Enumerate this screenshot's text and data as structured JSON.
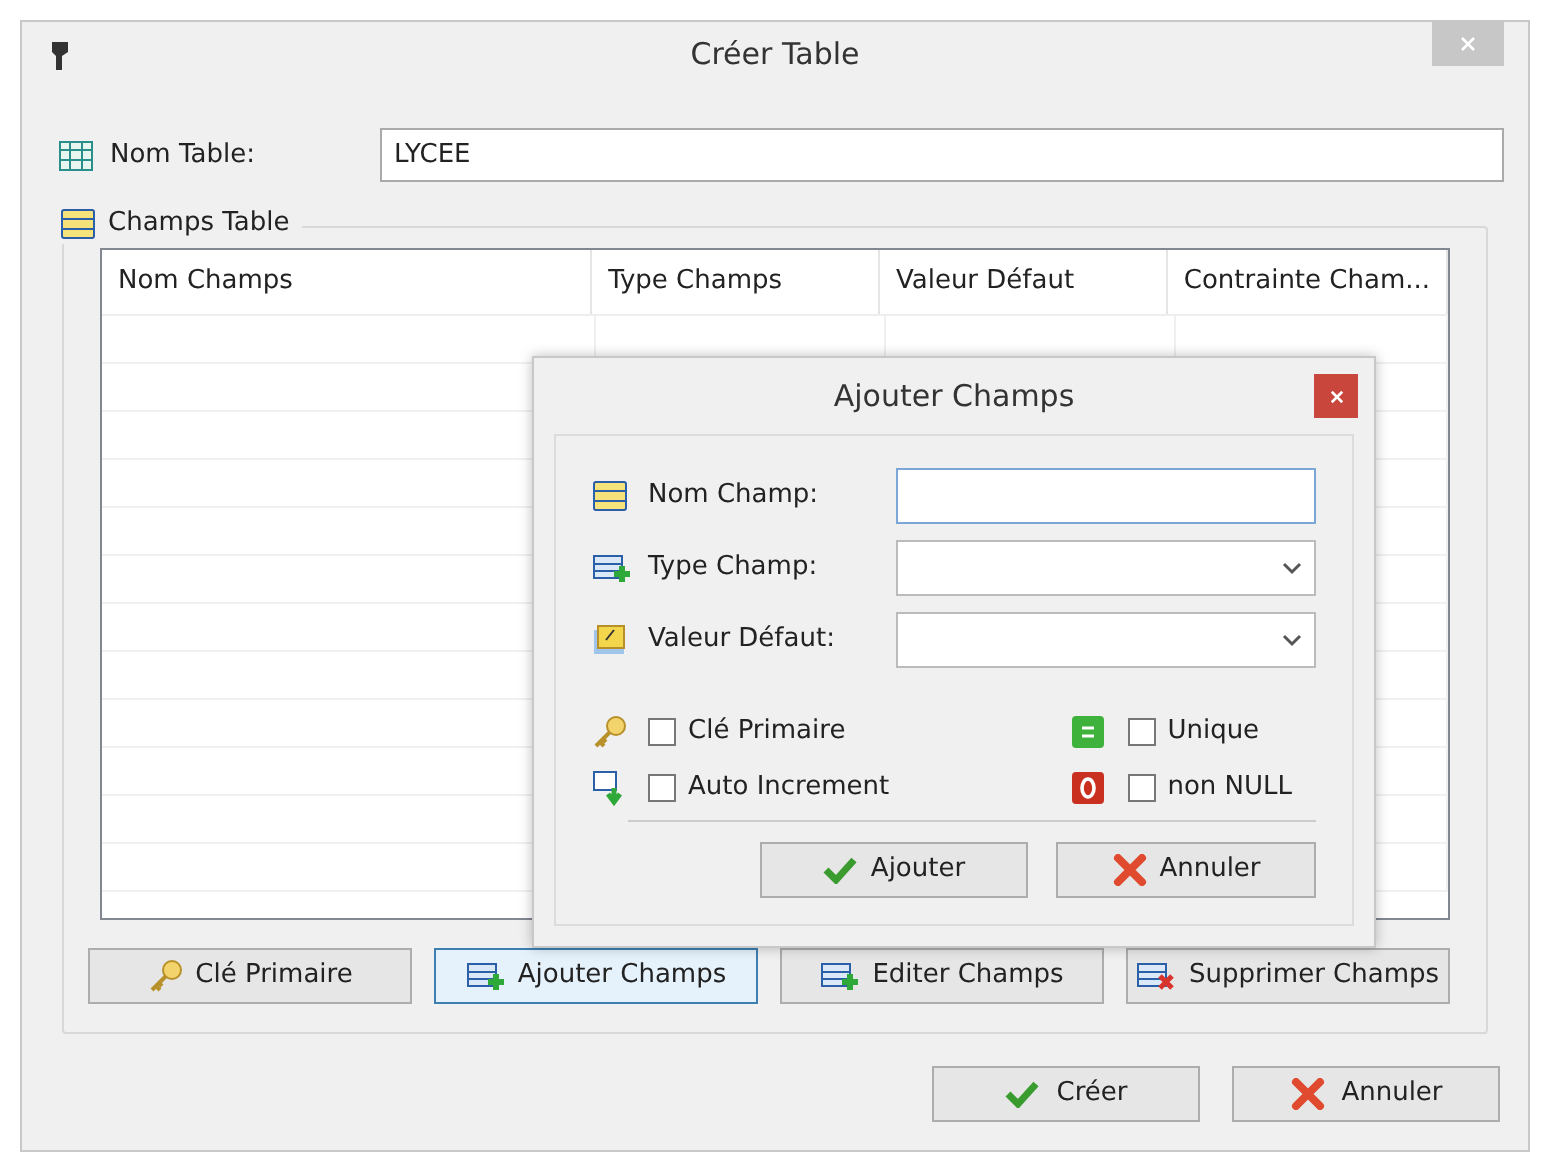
{
  "window": {
    "title": "Créer Table"
  },
  "table_name": {
    "label": "Nom Table:",
    "value": "LYCEE"
  },
  "fields_group": {
    "title": "Champs Table",
    "columns": [
      "Nom Champs",
      "Type Champs",
      "Valeur Défaut",
      "Contrainte Cham..."
    ],
    "buttons": [
      {
        "label": "Clé Primaire",
        "focused": false
      },
      {
        "label": "Ajouter Champs",
        "focused": true
      },
      {
        "label": "Editer Champs",
        "focused": false
      },
      {
        "label": "Supprimer Champs",
        "focused": false
      }
    ]
  },
  "buttons": [
    "Créer",
    "Annuler"
  ],
  "dialog": {
    "title": "Ajouter Champs",
    "fields": [
      {
        "kind": "text",
        "label": "Nom Champ:"
      },
      {
        "kind": "combo",
        "label": "Type Champ:"
      },
      {
        "kind": "combo",
        "label": "Valeur Défaut:"
      }
    ],
    "checks_left": [
      {
        "label": "Clé Primaire",
        "checked": false
      },
      {
        "label": "Auto Increment",
        "checked": false
      }
    ],
    "checks_right": [
      {
        "label": "Unique",
        "checked": false
      },
      {
        "label": "non NULL",
        "checked": false
      }
    ],
    "buttons": [
      "Ajouter",
      "Annuler"
    ]
  }
}
